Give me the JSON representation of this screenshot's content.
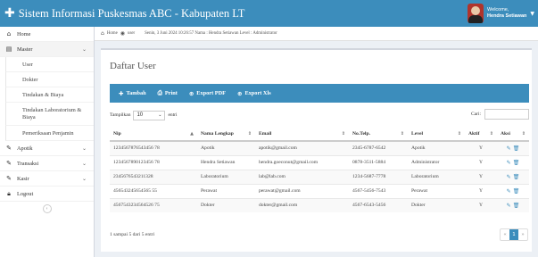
{
  "header": {
    "title": "Sistem Informasi Puskesmas ABC - Kabupaten LT",
    "user_greeting": "Welcome,",
    "user_name": "Hendra Setiawan"
  },
  "sidebar": {
    "items": [
      {
        "label": "Home",
        "icon": "home-icon"
      },
      {
        "label": "Master",
        "icon": "table-icon"
      },
      {
        "label": "User"
      },
      {
        "label": "Dokter"
      },
      {
        "label": "Tindakan & Biaya"
      },
      {
        "label": "Tindakan Laboratorium & Biaya"
      },
      {
        "label": "Pemeriksaan Penjamin"
      },
      {
        "label": "Apotik",
        "icon": "edit-icon"
      },
      {
        "label": "Transaksi",
        "icon": "edit-icon"
      },
      {
        "label": "Kasir",
        "icon": "edit-icon"
      },
      {
        "label": "Logout",
        "icon": "lock-icon"
      }
    ]
  },
  "breadcrumb": {
    "home": "Home",
    "current": "user",
    "info": "Senin, 3 Juni 2024 10:26:57 Nama : Hendra Setiawan Level : Administrator"
  },
  "panel": {
    "title": "Daftar User",
    "toolbar": {
      "add": "Tambah",
      "print": "Print",
      "pdf": "Export PDF",
      "xls": "Export Xls"
    },
    "length_label": "Tampilkan",
    "length_value": "10",
    "length_suffix": "entri",
    "search_label": "Cari:"
  },
  "table": {
    "columns": [
      "Nip",
      "Nama Lengkap",
      "Email",
      "No.Telp.",
      "Level",
      "Aktif",
      "Aksi"
    ],
    "rows": [
      [
        "1234567876543456 78",
        "Apotik",
        "apotik@gmail.com",
        "2345-6787-6542",
        "Apotik",
        "Y"
      ],
      [
        "1234567890123456 78",
        "Hendra Setiawan",
        "hendra.goeconut@gmail.com",
        "0878-3511-5884",
        "Administrator",
        "Y"
      ],
      [
        "2345676543211328",
        "Laboratorium",
        "lab@lab.com",
        "1234-5687-7778",
        "Laboratorium",
        "Y"
      ],
      [
        "456543245654565 55",
        "Perawat",
        "perawat@gmail.com",
        "4567-5456-7543",
        "Perawat",
        "Y"
      ],
      [
        "4567543234564526 75",
        "Dokter",
        "dokter@gmail.com",
        "4567-6543-5456",
        "Dokter",
        "Y"
      ]
    ]
  },
  "footer": {
    "info": "1 sampai 5 dari 5 entri",
    "page": "1",
    "prev": "«",
    "next": "»"
  },
  "colors": {
    "primary": "#3c8dbc",
    "background": "#ecf0f5"
  }
}
